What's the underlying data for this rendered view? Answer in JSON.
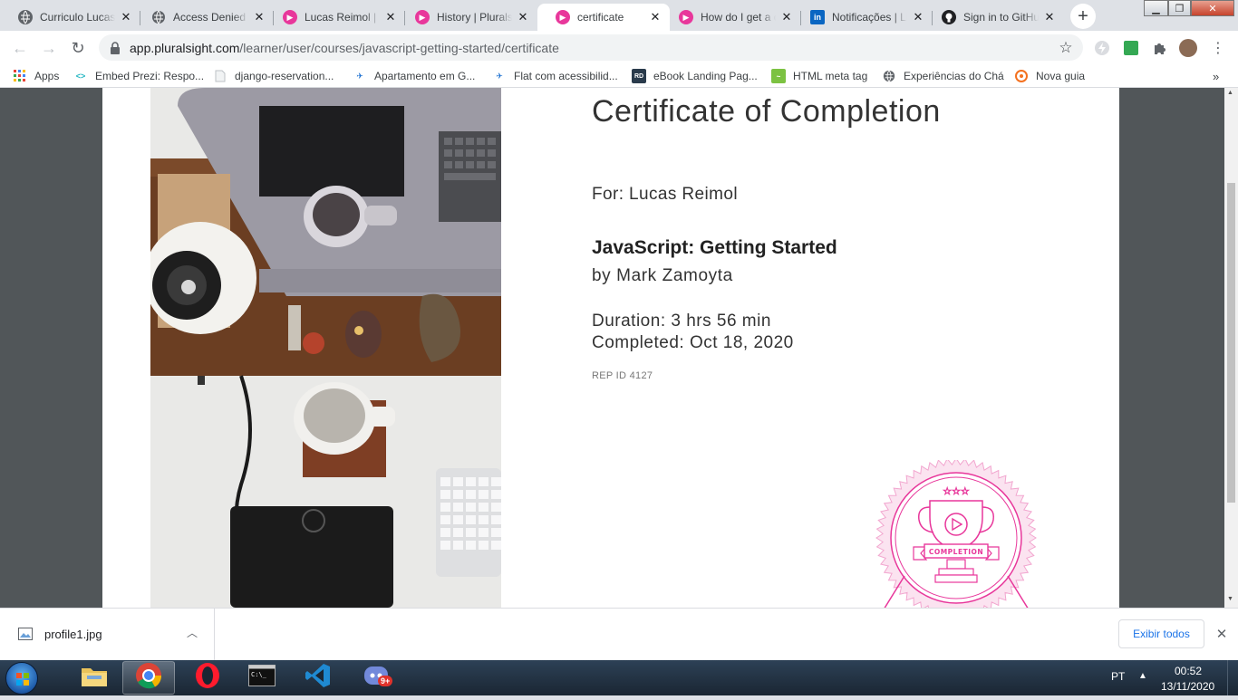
{
  "tabs": [
    {
      "title": "Curriculo Lucas",
      "favicon": "globe-icon"
    },
    {
      "title": "Access Denied",
      "favicon": "globe-icon"
    },
    {
      "title": "Lucas Reimol | Pluralsight",
      "favicon": "pluralsight-icon"
    },
    {
      "title": "History | Pluralsight",
      "favicon": "pluralsight-icon"
    },
    {
      "title": "certificate",
      "favicon": "pluralsight-icon",
      "active": true
    },
    {
      "title": "How do I get a certificate",
      "favicon": "pluralsight-icon"
    },
    {
      "title": "Notificações | LinkedIn",
      "favicon": "linkedin-icon"
    },
    {
      "title": "Sign in to GitHub",
      "favicon": "github-icon"
    }
  ],
  "address": {
    "url_host": "app.pluralsight.com",
    "url_path": "/learner/user/courses/javascript-getting-started/certificate"
  },
  "bookmarks": [
    {
      "label": "Apps"
    },
    {
      "label": "Embed Prezi: Respo..."
    },
    {
      "label": "django-reservation..."
    },
    {
      "label": "Apartamento em G..."
    },
    {
      "label": "Flat com acessibilid..."
    },
    {
      "label": "eBook Landing Pag..."
    },
    {
      "label": "HTML meta tag"
    },
    {
      "label": "Experiências do Chá"
    },
    {
      "label": "Nova guia"
    }
  ],
  "certificate": {
    "title": "Certificate of Completion",
    "for_line": "For: Lucas Reimol",
    "course": "JavaScript: Getting Started",
    "author_line": "by Mark Zamoyta",
    "duration_line": "Duration: 3 hrs 56 min",
    "completed_line": "Completed: Oct 18, 2020",
    "rep_id": "REP ID 4127",
    "badge_label": "COMPLETION",
    "accent_color": "#e8379b"
  },
  "downloads": {
    "file_name": "profile1.jpg",
    "show_all_label": "Exibir todos"
  },
  "taskbar": {
    "language": "PT",
    "time": "00:52",
    "date": "13/11/2020",
    "discord_badge": "9+"
  }
}
